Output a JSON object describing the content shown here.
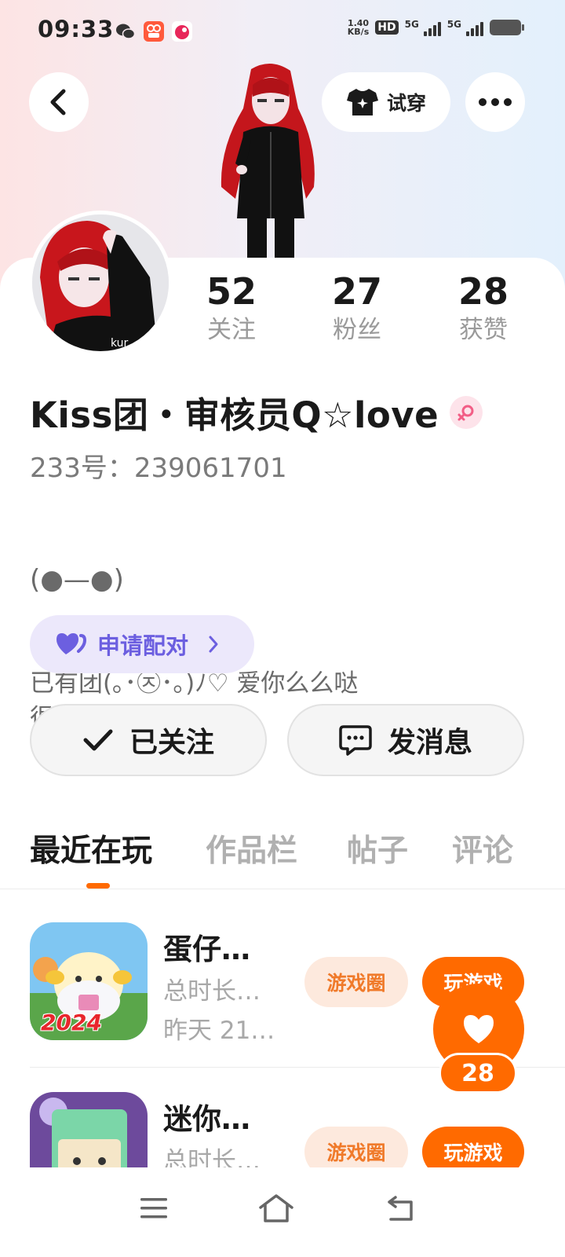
{
  "status_bar": {
    "time": "09:33",
    "net_speed_value": "1.40",
    "net_speed_unit": "KB/s",
    "hd": "HD",
    "network1": "5G",
    "network2": "5G",
    "notification_icons": [
      "wechat-icon",
      "app-icon",
      "app-icon-2"
    ]
  },
  "header": {
    "try_on_label": "试穿",
    "back_icon": "chevron-left-icon",
    "more_icon": "more-dots-icon"
  },
  "profile": {
    "stats": [
      {
        "value": "52",
        "label": "关注"
      },
      {
        "value": "27",
        "label": "粉丝"
      },
      {
        "value": "28",
        "label": "获赞"
      }
    ],
    "name": "Kiss团・审核员Q☆love",
    "gender": "female",
    "uid": "233号：239061701",
    "bio_line1": "(●—●)",
    "bio_rest": "已有团(｡･㉨･｡)ﾉ♡ 爱你么么哒\n很爱Emo"
  },
  "pair_button": {
    "label": "申请配对"
  },
  "actions": {
    "followed_label": "已关注",
    "message_label": "发消息"
  },
  "tabs": [
    {
      "label": "最近在玩",
      "active": true
    },
    {
      "label": "作品栏",
      "active": false
    },
    {
      "label": "帖子",
      "active": false
    },
    {
      "label": "评论",
      "active": false
    }
  ],
  "games": [
    {
      "title": "蛋仔…",
      "total_time": "总时长…",
      "last_played": "昨天 21…",
      "circle_label": "游戏圈",
      "play_label": "玩游戏",
      "icon_badge": "2024"
    },
    {
      "title": "迷你…",
      "total_time": "总时长…",
      "circle_label": "游戏圈",
      "play_label": "玩游戏"
    }
  ],
  "like_fab": {
    "count": "28"
  },
  "colors": {
    "accent": "#ff6a00",
    "pair_purple": "#6c5fe0",
    "pair_bg": "#ece8fb",
    "chip_bg": "#fde9dd"
  }
}
